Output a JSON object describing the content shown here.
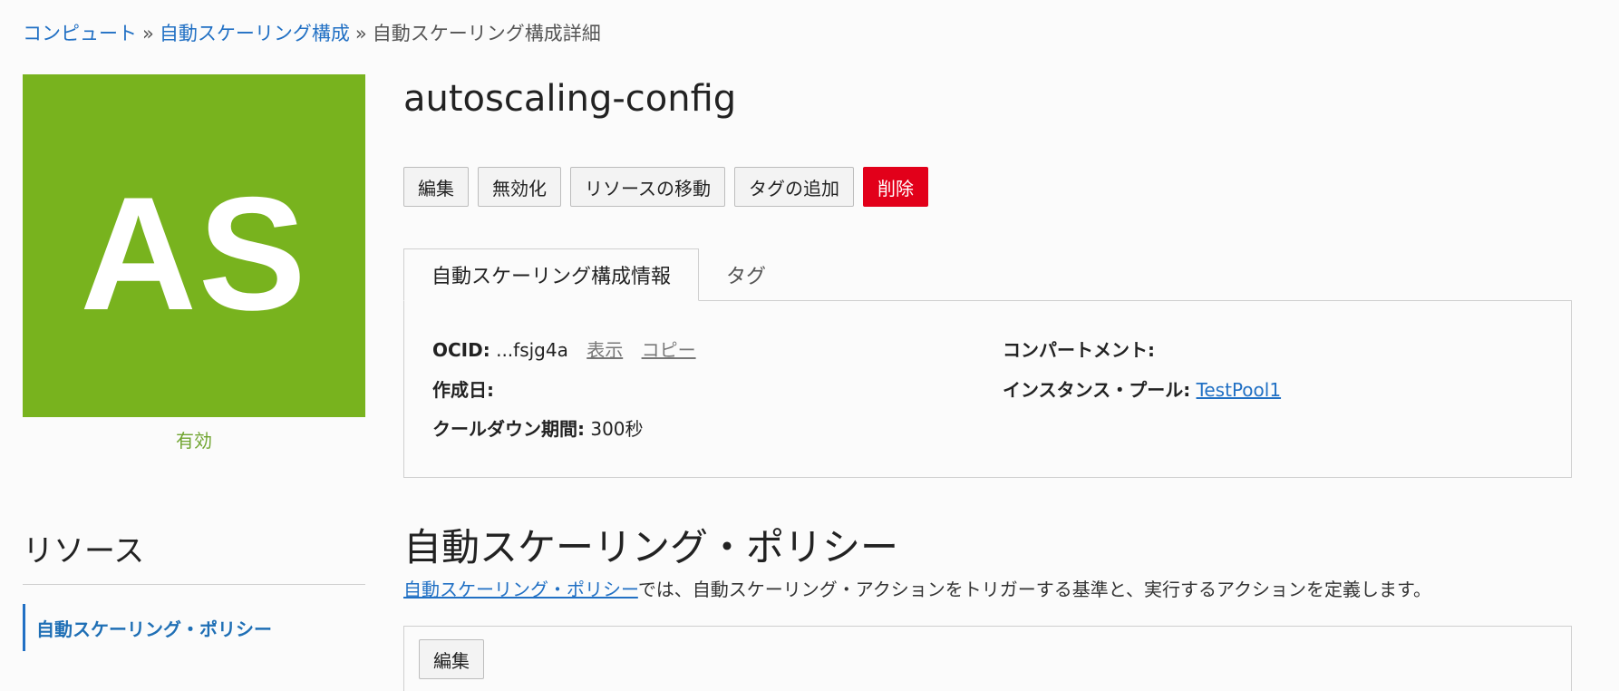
{
  "breadcrumb": {
    "items": [
      "コンピュート",
      "自動スケーリング構成"
    ],
    "separator": "»",
    "current": "自動スケーリング構成詳細"
  },
  "avatar": {
    "initials": "AS",
    "color": "#78b31e",
    "state": "有効"
  },
  "resources": {
    "title": "リソース",
    "items": [
      "自動スケーリング・ポリシー"
    ]
  },
  "header": {
    "title": "autoscaling-config"
  },
  "actions": {
    "edit": "編集",
    "disable": "無効化",
    "move": "リソースの移動",
    "add_tags": "タグの追加",
    "delete": "削除"
  },
  "tabs": [
    {
      "label": "自動スケーリング構成情報",
      "active": true
    },
    {
      "label": "タグ",
      "active": false
    }
  ],
  "info": {
    "ocid_label": "OCID:",
    "ocid_value": "...fsjg4a",
    "show": "表示",
    "copy": "コピー",
    "created_label": "作成日:",
    "cooldown_label": "クールダウン期間:",
    "cooldown_value": "300秒",
    "compartment_label": "コンパートメント:",
    "pool_label": "インスタンス・プール:",
    "pool_value": "TestPool1"
  },
  "policies": {
    "title": "自動スケーリング・ポリシー",
    "desc_link": "自動スケーリング・ポリシー",
    "desc_rest": "では、自動スケーリング・アクションをトリガーする基準と、実行するアクションを定義します。",
    "edit_button": "編集"
  },
  "colors": {
    "link": "#2170c4",
    "danger": "#e2001a",
    "state": "#6fa42e"
  }
}
